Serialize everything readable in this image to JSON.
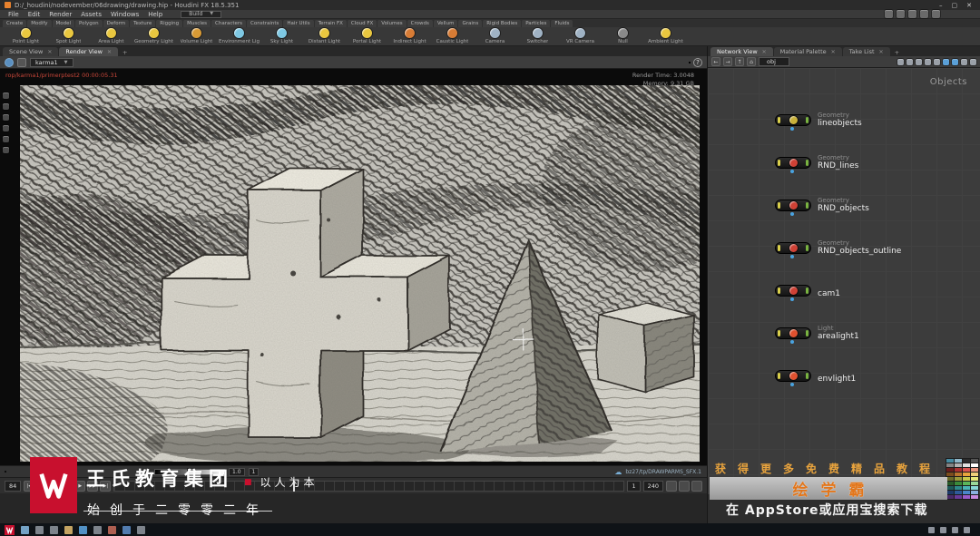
{
  "titlebar": {
    "title": "D:/_houdini/nodevember/06drawing/drawing.hip - Houdini FX 18.5.351",
    "minimize": "–",
    "maximize": "▢",
    "close": "✕"
  },
  "menubar": {
    "menus": [
      "File",
      "Edit",
      "Render",
      "Assets",
      "Windows",
      "Help"
    ],
    "desktop_selector": "Build",
    "icons": [
      {
        "name": "layout-icon"
      },
      {
        "name": "panes-icon"
      },
      {
        "name": "split-icon"
      },
      {
        "name": "radial-menu-icon"
      },
      {
        "name": "help-icon"
      }
    ]
  },
  "shelf": {
    "tabs": [
      "Create",
      "Modify",
      "Model",
      "Polygon",
      "Deform",
      "Texture",
      "Rigging",
      "Muscles",
      "Characters",
      "Constraints",
      "Hair Utils",
      "Terrain FX",
      "Cloud FX",
      "Volumes",
      "Crowds",
      "Vellum",
      "Grains",
      "Rigid Bodies",
      "Particles",
      "Fluids"
    ],
    "tools": [
      {
        "label": "Point Light",
        "c": "#e9c73f"
      },
      {
        "label": "Spot Light",
        "c": "#e9c73f"
      },
      {
        "label": "Area Light",
        "c": "#e9c73f"
      },
      {
        "label": "Geometry Light",
        "c": "#e9c73f"
      },
      {
        "label": "Volume Light",
        "c": "#d89a35"
      },
      {
        "label": "Environment Light",
        "c": "#7ec8e3"
      },
      {
        "label": "Sky Light",
        "c": "#7ec8e3"
      },
      {
        "label": "Distant Light",
        "c": "#e9c73f"
      },
      {
        "label": "Portal Light",
        "c": "#e9c73f"
      },
      {
        "label": "Indirect Light",
        "c": "#d87c35"
      },
      {
        "label": "Caustic Light",
        "c": "#d87c35"
      },
      {
        "label": "Camera",
        "c": "#9fb2c4"
      },
      {
        "label": "Switcher",
        "c": "#9fb2c4"
      },
      {
        "label": "VR Camera",
        "c": "#9fb2c4"
      },
      {
        "label": "Null",
        "c": "#8a8a8a"
      },
      {
        "label": "Ambient Light",
        "c": "#e9c73f"
      }
    ]
  },
  "left_pane": {
    "tabs": [
      "Scene View",
      "Render View"
    ],
    "toolbar": {
      "rop": "karma1",
      "help": "?",
      "right_icons": [
        {
          "name": "snapshot-icon",
          "c": "#9aa0a8"
        },
        {
          "name": "checker-background-icon",
          "c": "#7fc87f"
        },
        {
          "name": "color-correct-icon",
          "c": "#d8a040"
        },
        {
          "name": "gamma-icon",
          "c": "#9aa0a8"
        },
        {
          "name": "zoom-icon",
          "c": "#9aa0a8"
        },
        {
          "name": "expand-icon",
          "c": "#9aa0a8"
        }
      ]
    },
    "viewport_tools": [
      {
        "name": "select-tool-icon"
      },
      {
        "name": "move-tool-icon"
      },
      {
        "name": "rotate-tool-icon"
      },
      {
        "name": "scale-tool-icon"
      },
      {
        "name": "handles-tool-icon"
      },
      {
        "name": "snap-tool-icon"
      }
    ],
    "status": {
      "rop_path": "rop/karma1/primerptest2 00:00:05.31",
      "render_time_label": "Render Time:",
      "render_time": "3.0048",
      "memory_label": "Memory:",
      "memory": "9.31 GB"
    },
    "bottom": {
      "chips": [
        {
          "name": "snapshot-camera-icon",
          "c": "#8a9098"
        },
        {
          "name": "ab-wipe-icon",
          "c": "#8a9098"
        },
        {
          "name": "histogram-icon",
          "c": "#8a9098"
        }
      ],
      "gamma": "1.0",
      "res": "1",
      "path": "bz27/tp/DRAWPARMS_SFX.1"
    },
    "playbar": {
      "current": "84",
      "start": "1",
      "end": "240",
      "transport": [
        "|◀",
        "◀◀",
        "◀",
        "■",
        "▶",
        "▶▶",
        "▶|"
      ],
      "right_icons": [
        {
          "name": "audio-icon"
        },
        {
          "name": "realtime-icon"
        },
        {
          "name": "playback-options-icon"
        }
      ]
    }
  },
  "right_pane": {
    "tabs": [
      "Network View",
      "Material Palette",
      "Take List"
    ],
    "nav": {
      "back": "←",
      "forward": "→",
      "up": "↑",
      "home": "⌂",
      "path": "obj"
    },
    "toolbar_icons": [
      {
        "name": "scissors-icon",
        "c": "#9aa0a8"
      },
      {
        "name": "wrench-icon",
        "c": "#9aa0a8"
      },
      {
        "name": "display-icon",
        "c": "#9aa0a8"
      },
      {
        "name": "grid-snap-icon",
        "c": "#9aa0a8"
      },
      {
        "name": "columns-icon",
        "c": "#9aa0a8"
      },
      {
        "name": "blue-panel-icon",
        "c": "#5aa0d8"
      },
      {
        "name": "blue-panel2-icon",
        "c": "#5aa0d8"
      },
      {
        "name": "search-icon",
        "c": "#9aa0a8"
      },
      {
        "name": "menu-icon",
        "c": "#9aa0a8"
      }
    ],
    "context_label": "Objects",
    "nodes": [
      {
        "category": "Geometry",
        "name": "lineobjects",
        "icon_c": "#c8b03a"
      },
      {
        "category": "Geometry",
        "name": "RND_lines",
        "icon_c": "#cf4135"
      },
      {
        "category": "Geometry",
        "name": "RND_objects",
        "icon_c": "#cf4135"
      },
      {
        "category": "Geometry",
        "name": "RND_objects_outline",
        "icon_c": "#cf4135"
      },
      {
        "category": "",
        "name": "cam1",
        "icon_c": "#cf4135"
      },
      {
        "category": "Light",
        "name": "arealight1",
        "icon_c": "#e0512f"
      },
      {
        "category": "",
        "name": "envlight1",
        "icon_c": "#e0512f"
      }
    ],
    "palette": [
      "#478ba2",
      "#8fb6c8",
      "#2b2b2b",
      "#545454",
      "#838383",
      "#b1b1b1",
      "#e0e0e0",
      "#ffffff",
      "#6b1d1d",
      "#aa2f2f",
      "#d9534f",
      "#e8937c",
      "#7c4d1e",
      "#b8742e",
      "#e8a33d",
      "#f0cf7a",
      "#6a6a2a",
      "#9a9a3a",
      "#c8c84a",
      "#e8e87a",
      "#2a5a2a",
      "#3a8a3a",
      "#5ab55a",
      "#9ad89a",
      "#1e5a5a",
      "#2e8a8a",
      "#4ab5b5",
      "#8ad8d8",
      "#1e3a6a",
      "#2e5a9a",
      "#4a85c8",
      "#8ab0e0",
      "#4a2a6a",
      "#6a3a9a",
      "#9a5ac8",
      "#c88ae0"
    ]
  },
  "promo": {
    "line1": "获得更多免费精品教程",
    "brand": "绘学霸",
    "line2": "在 AppStore或应用宝搜索下载"
  },
  "watermark": {
    "company": "王氏教育集团",
    "bullet": "■",
    "slogan": "以人为本",
    "since": "始创于二零零二年"
  },
  "taskbar": {
    "icons": [
      {
        "name": "start-icon",
        "c": "#7fb3d8"
      },
      {
        "name": "search-icon",
        "c": "#8a9098"
      },
      {
        "name": "task-view-icon",
        "c": "#8a9098"
      },
      {
        "name": "explorer-icon",
        "c": "#d8b46a"
      },
      {
        "name": "browser-icon",
        "c": "#5aa0d8"
      },
      {
        "name": "store-icon",
        "c": "#8a9098"
      },
      {
        "name": "media-icon",
        "c": "#c06858"
      },
      {
        "name": "code-icon",
        "c": "#5a88c0"
      },
      {
        "name": "chat-icon",
        "c": "#8a9098"
      }
    ],
    "tray": [
      {
        "name": "tray-chevron-icon",
        "c": "#9aa0a8"
      },
      {
        "name": "network-icon",
        "c": "#9aa0a8"
      },
      {
        "name": "volume-icon",
        "c": "#9aa0a8"
      },
      {
        "name": "notification-icon",
        "c": "#9aa0a8"
      }
    ]
  },
  "colors": {
    "accent_orange": "#e8822e",
    "brand_red": "#c8102e",
    "flag_blue": "#49a3e0"
  }
}
